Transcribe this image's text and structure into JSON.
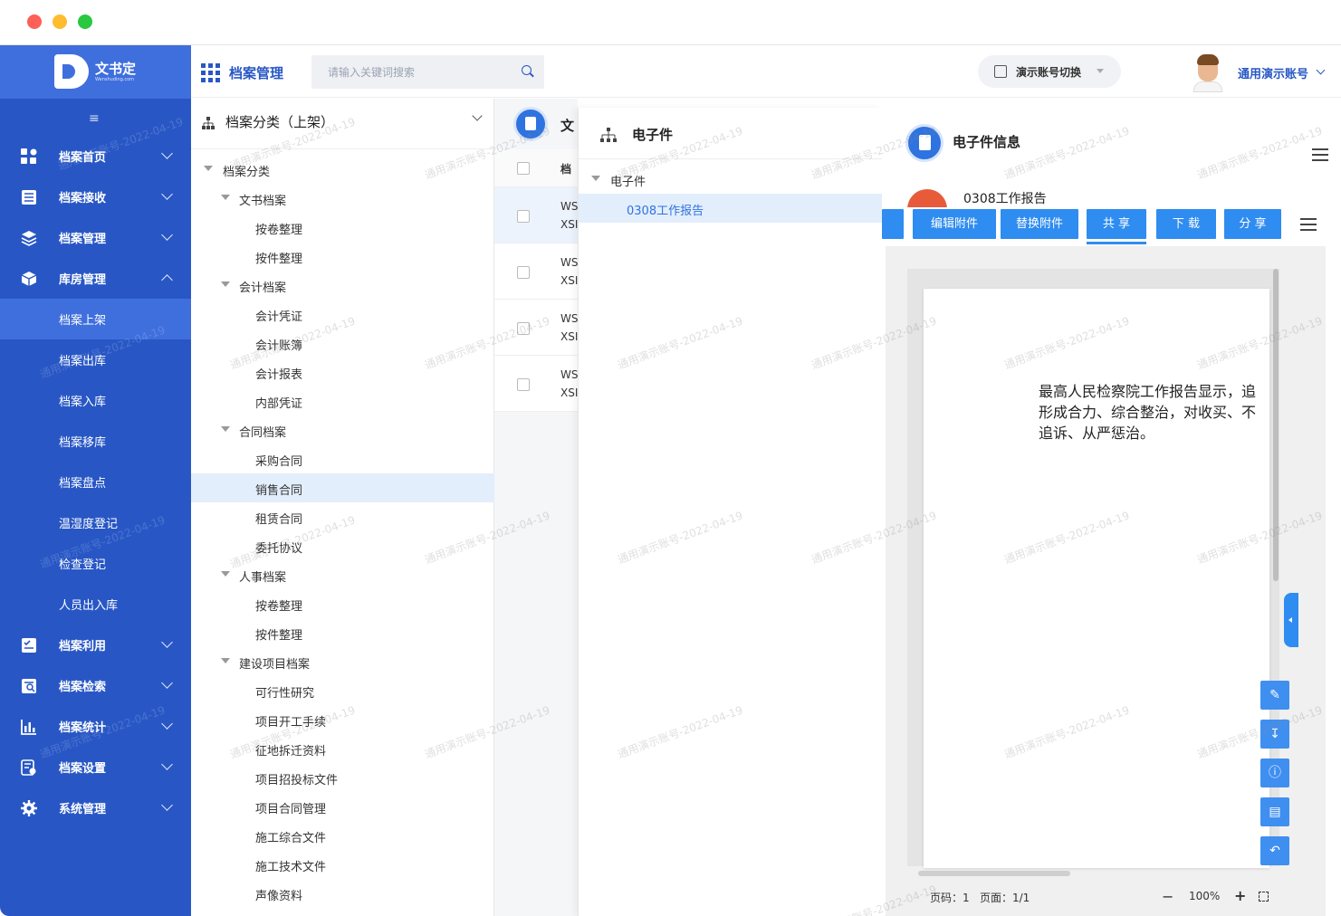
{
  "window_title": "",
  "brand": {
    "name": "文书定",
    "tagline": "Wenshuding.com"
  },
  "sidebar": {
    "collapse_icon": "menu-fold-icon",
    "items": [
      {
        "label": "档案首页",
        "icon": "dashboard-icon",
        "expanded": false
      },
      {
        "label": "档案接收",
        "icon": "receive-icon",
        "expanded": false
      },
      {
        "label": "档案管理",
        "icon": "layers-icon",
        "expanded": false
      },
      {
        "label": "库房管理",
        "icon": "cube-icon",
        "expanded": true,
        "children": [
          "档案上架",
          "档案出库",
          "档案入库",
          "档案移库",
          "档案盘点",
          "温湿度登记",
          "检查登记",
          "人员出入库"
        ],
        "active_child": "档案上架"
      },
      {
        "label": "档案利用",
        "icon": "checklist-icon",
        "expanded": false
      },
      {
        "label": "档案检索",
        "icon": "search-doc-icon",
        "expanded": false
      },
      {
        "label": "档案统计",
        "icon": "bar-chart-icon",
        "expanded": false
      },
      {
        "label": "档案设置",
        "icon": "settings-doc-icon",
        "expanded": false
      },
      {
        "label": "系统管理",
        "icon": "gear-icon",
        "expanded": false
      }
    ]
  },
  "header": {
    "title": "档案管理",
    "search_placeholder": "请输入关键词搜索",
    "switch_label": "演示账号切换",
    "user_name": "通用演示账号"
  },
  "category_tree": {
    "title": "档案分类（上架）",
    "nodes": [
      {
        "label": "档案分类",
        "level": 0,
        "expandable": true
      },
      {
        "label": "文书档案",
        "level": 1,
        "expandable": true
      },
      {
        "label": "按卷整理",
        "level": 2
      },
      {
        "label": "按件整理",
        "level": 2
      },
      {
        "label": "会计档案",
        "level": 1,
        "expandable": true
      },
      {
        "label": "会计凭证",
        "level": 2
      },
      {
        "label": "会计账簿",
        "level": 2
      },
      {
        "label": "会计报表",
        "level": 2
      },
      {
        "label": "内部凭证",
        "level": 2
      },
      {
        "label": "合同档案",
        "level": 1,
        "expandable": true
      },
      {
        "label": "采购合同",
        "level": 2
      },
      {
        "label": "销售合同",
        "level": 2,
        "active": true
      },
      {
        "label": "租赁合同",
        "level": 2
      },
      {
        "label": "委托协议",
        "level": 2
      },
      {
        "label": "人事档案",
        "level": 1,
        "expandable": true
      },
      {
        "label": "按卷整理",
        "level": 2
      },
      {
        "label": "按件整理",
        "level": 2
      },
      {
        "label": "建设项目档案",
        "level": 1,
        "expandable": true
      },
      {
        "label": "可行性研究",
        "level": 2
      },
      {
        "label": "项目开工手续",
        "level": 2
      },
      {
        "label": "征地拆迁资料",
        "level": 2
      },
      {
        "label": "项目招投标文件",
        "level": 2
      },
      {
        "label": "项目合同管理",
        "level": 2
      },
      {
        "label": "施工综合文件",
        "level": 2
      },
      {
        "label": "施工技术文件",
        "level": 2
      },
      {
        "label": "声像资料",
        "level": 2
      }
    ]
  },
  "file_list": {
    "title": "文",
    "column_header": "档",
    "rows": [
      {
        "line1": "WS",
        "line2": "XSI",
        "selected": true
      },
      {
        "line1": "WS",
        "line2": "XSI"
      },
      {
        "line1": "WS",
        "line2": "XSI"
      },
      {
        "line1": "WS",
        "line2": "XSI"
      }
    ]
  },
  "efile_panel": {
    "title": "电子件",
    "root": "电子件",
    "selected_file": "0308工作报告"
  },
  "viewer": {
    "title": "电子件信息",
    "file_tab": "0308工作报告",
    "buttons": [
      "编辑附件",
      "替换附件",
      "共 享",
      "下 载",
      "分 享"
    ],
    "document_lines": [
      "最高人民检察院工作报告显示，追",
      "形成合力、综合整治，对收买、不",
      "追诉、从严惩治。"
    ],
    "side_tools": [
      "edit-icon",
      "download-icon",
      "info-icon",
      "note-icon",
      "undo-icon"
    ],
    "status": {
      "page_label": "页码：1",
      "pages_label": "页面：1/1",
      "zoom": "100%"
    }
  },
  "watermark": "通用演示账号-2022-04-19",
  "colors": {
    "sidebar": "#2857c5",
    "accent": "#2f8cf0",
    "brand_dark": "#2f73e0"
  }
}
